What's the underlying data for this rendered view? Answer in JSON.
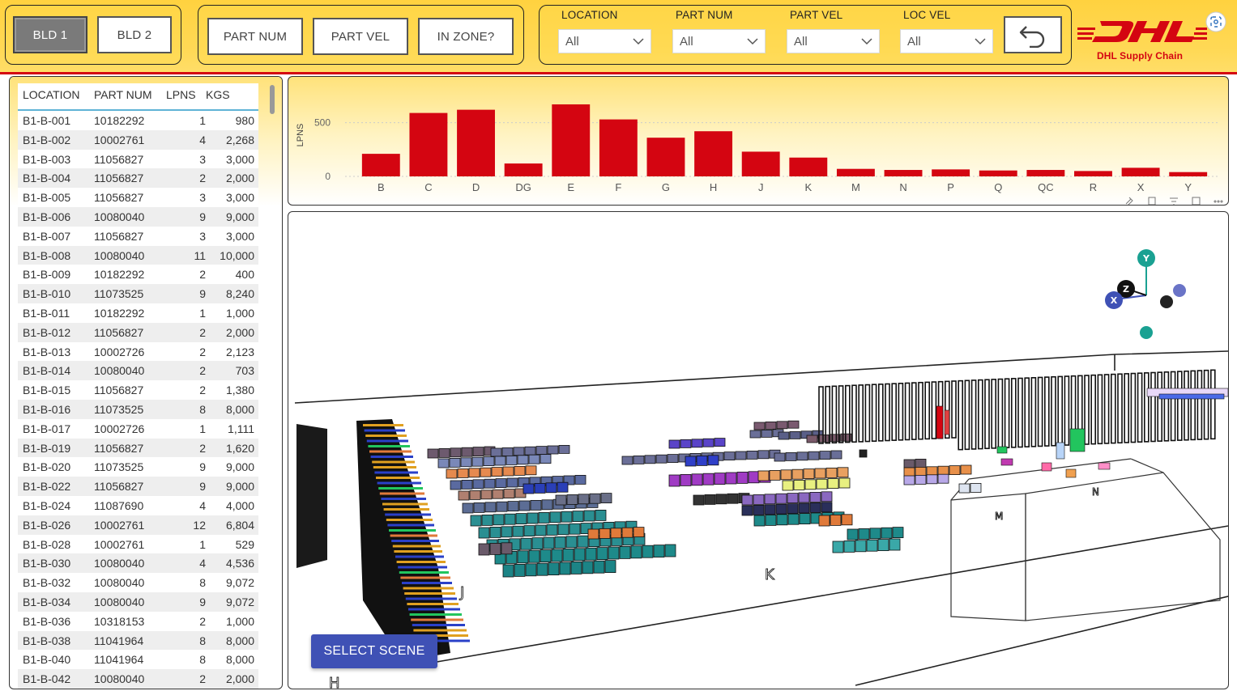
{
  "header": {
    "buildings": [
      {
        "label": "BLD 1",
        "active": true
      },
      {
        "label": "BLD 2",
        "active": false
      }
    ],
    "view_buttons": [
      "PART NUM",
      "PART VEL",
      "IN ZONE?"
    ],
    "filters": [
      {
        "label": "LOCATION",
        "value": "All"
      },
      {
        "label": "PART NUM",
        "value": "All"
      },
      {
        "label": "PART VEL",
        "value": "All"
      },
      {
        "label": "LOC VEL",
        "value": "All"
      }
    ],
    "logo_subtitle": "DHL Supply Chain",
    "colors": {
      "brand_yellow": "#ffcc00",
      "brand_red": "#d40511"
    }
  },
  "table": {
    "columns": [
      "LOCATION",
      "PART NUM",
      "LPNS",
      "KGS"
    ],
    "rows": [
      [
        "B1-B-001",
        "10182292",
        "1",
        "980"
      ],
      [
        "B1-B-002",
        "10002761",
        "4",
        "2,268"
      ],
      [
        "B1-B-003",
        "11056827",
        "3",
        "3,000"
      ],
      [
        "B1-B-004",
        "11056827",
        "2",
        "2,000"
      ],
      [
        "B1-B-005",
        "11056827",
        "3",
        "3,000"
      ],
      [
        "B1-B-006",
        "10080040",
        "9",
        "9,000"
      ],
      [
        "B1-B-007",
        "11056827",
        "3",
        "3,000"
      ],
      [
        "B1-B-008",
        "10080040",
        "11",
        "10,000"
      ],
      [
        "B1-B-009",
        "10182292",
        "2",
        "400"
      ],
      [
        "B1-B-010",
        "11073525",
        "9",
        "8,240"
      ],
      [
        "B1-B-011",
        "10182292",
        "1",
        "1,000"
      ],
      [
        "B1-B-012",
        "11056827",
        "2",
        "2,000"
      ],
      [
        "B1-B-013",
        "10002726",
        "2",
        "2,123"
      ],
      [
        "B1-B-014",
        "10080040",
        "2",
        "703"
      ],
      [
        "B1-B-015",
        "11056827",
        "2",
        "1,380"
      ],
      [
        "B1-B-016",
        "11073525",
        "8",
        "8,000"
      ],
      [
        "B1-B-017",
        "10002726",
        "1",
        "1,111"
      ],
      [
        "B1-B-019",
        "11056827",
        "2",
        "1,620"
      ],
      [
        "B1-B-020",
        "11073525",
        "9",
        "9,000"
      ],
      [
        "B1-B-022",
        "11056827",
        "9",
        "9,000"
      ],
      [
        "B1-B-024",
        "11087690",
        "4",
        "4,000"
      ],
      [
        "B1-B-026",
        "10002761",
        "12",
        "6,804"
      ],
      [
        "B1-B-028",
        "10002761",
        "1",
        "529"
      ],
      [
        "B1-B-030",
        "10080040",
        "4",
        "4,536"
      ],
      [
        "B1-B-032",
        "10080040",
        "8",
        "9,072"
      ],
      [
        "B1-B-034",
        "10080040",
        "9",
        "9,072"
      ],
      [
        "B1-B-036",
        "10318153",
        "2",
        "1,000"
      ],
      [
        "B1-B-038",
        "11041964",
        "8",
        "8,000"
      ],
      [
        "B1-B-040",
        "11041964",
        "8",
        "8,000"
      ],
      [
        "B1-B-042",
        "10080040",
        "2",
        "2,000"
      ]
    ]
  },
  "chart_data": {
    "type": "bar",
    "categories": [
      "B",
      "C",
      "D",
      "DG",
      "E",
      "F",
      "G",
      "H",
      "J",
      "K",
      "M",
      "N",
      "P",
      "Q",
      "QC",
      "R",
      "X",
      "Y"
    ],
    "values": [
      210,
      590,
      620,
      120,
      670,
      530,
      360,
      420,
      230,
      175,
      70,
      60,
      65,
      55,
      60,
      50,
      80,
      40
    ],
    "ylabel": "LPNS",
    "yticks": [
      "0",
      "500"
    ],
    "ylim": [
      0,
      700
    ],
    "bar_color": "#d40511",
    "grid": true
  },
  "scene": {
    "button_label": "SELECT SCENE",
    "axis_labels": {
      "x": "X",
      "y": "Y",
      "z": "Z"
    },
    "zone_labels": [
      "J",
      "K",
      "H",
      "N",
      "M"
    ]
  }
}
